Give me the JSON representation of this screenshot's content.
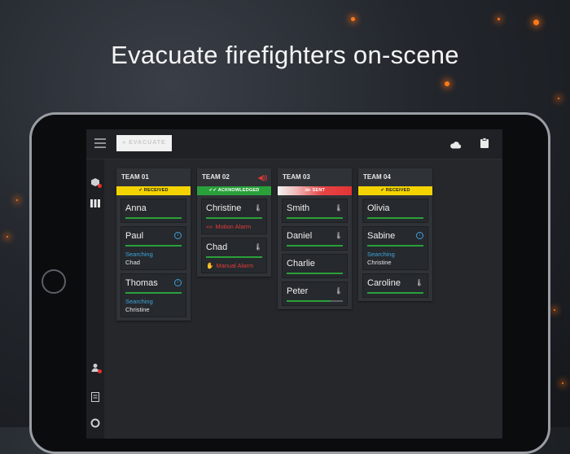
{
  "headline": "Evacuate firefighters on-scene",
  "toolbar": {
    "evacuate_label": "EVACUATE",
    "cloud_icon": "cloud-icon",
    "clipboard_icon": "clipboard-icon"
  },
  "colors": {
    "received": "#f4d400",
    "acknowledged": "#2aa03b",
    "sent": "#e33434",
    "info": "#3ea5dc",
    "alarm": "#e13c3c"
  },
  "teams": [
    {
      "name": "TEAM 01",
      "status": "RECEIVED",
      "members": [
        {
          "name": "Anna"
        },
        {
          "name": "Paul",
          "sub_status": "Searching",
          "sub_value": "Chad"
        },
        {
          "name": "Thomas",
          "sub_status": "Searching",
          "sub_value": "Christine"
        }
      ]
    },
    {
      "name": "TEAM 02",
      "status": "ACKNOWLEDGED",
      "members": [
        {
          "name": "Christine",
          "alarm": "Motion Alarm"
        },
        {
          "name": "Chad",
          "alarm": "Manual Alarm"
        }
      ]
    },
    {
      "name": "TEAM 03",
      "status": "SENT",
      "members": [
        {
          "name": "Smith"
        },
        {
          "name": "Daniel"
        },
        {
          "name": "Charlie"
        },
        {
          "name": "Peter"
        }
      ]
    },
    {
      "name": "TEAM 04",
      "status": "RECEIVED",
      "members": [
        {
          "name": "Olivia"
        },
        {
          "name": "Sabine",
          "sub_status": "Searching",
          "sub_value": "Christine"
        },
        {
          "name": "Caroline"
        }
      ]
    }
  ]
}
